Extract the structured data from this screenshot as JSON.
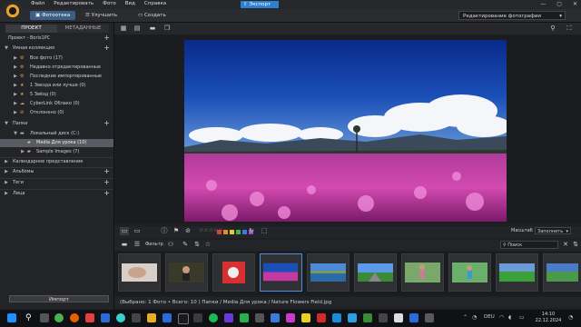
{
  "menubar": {
    "items": [
      "Файл",
      "Редактировать",
      "Фото",
      "Вид",
      "Справка"
    ],
    "export_label": "Экспорт"
  },
  "toolbar": {
    "photos_label": "Фотоотека",
    "improve_label": "Улучшить",
    "create_label": "Создать",
    "mode_label": "Редактирование фотографии"
  },
  "left_panel": {
    "tab_project": "ПРОЕКТ",
    "tab_metadata": "МЕТАДАННЫЕ",
    "project_title": "Проект - Boris1PC",
    "smart_collection": "Умная коллекция",
    "smart_items": [
      "Все фото (17)",
      "Недавно отредактированные",
      "Последние импортированные",
      "1 Звезда или лучше (0)",
      "5 Звёзд (0)",
      "CyberLink Облако (0)",
      "Отклонено (0)"
    ],
    "folders": "Папки",
    "local_disk": "Локальный диск (C:)",
    "media_folder": "Media Для урока (10)",
    "sample_folder": "Sample Images (7)",
    "calendar": "Календарное представление",
    "albums": "Альбомы",
    "tags": "Теги",
    "faces": "Лица",
    "import_label": "Импорт"
  },
  "controls": {
    "filter_label": "Фильтр",
    "zoom_label": "Масштаб",
    "fit_label": "Заполнить",
    "search_placeholder": "Поиск",
    "color_labels": [
      "#d94040",
      "#e08a2a",
      "#e0d02a",
      "#4ab04a",
      "#3a7ad9",
      "#9a4ad9",
      "#888888"
    ]
  },
  "status": {
    "text": "(Выбрано: 1 Фото • Всего: 10 ) Папки / Media Для урока / Nature Flowers Field.jpg"
  },
  "taskbar": {
    "lang": "DEU",
    "time": "14:10",
    "date": "22.12.2024"
  }
}
